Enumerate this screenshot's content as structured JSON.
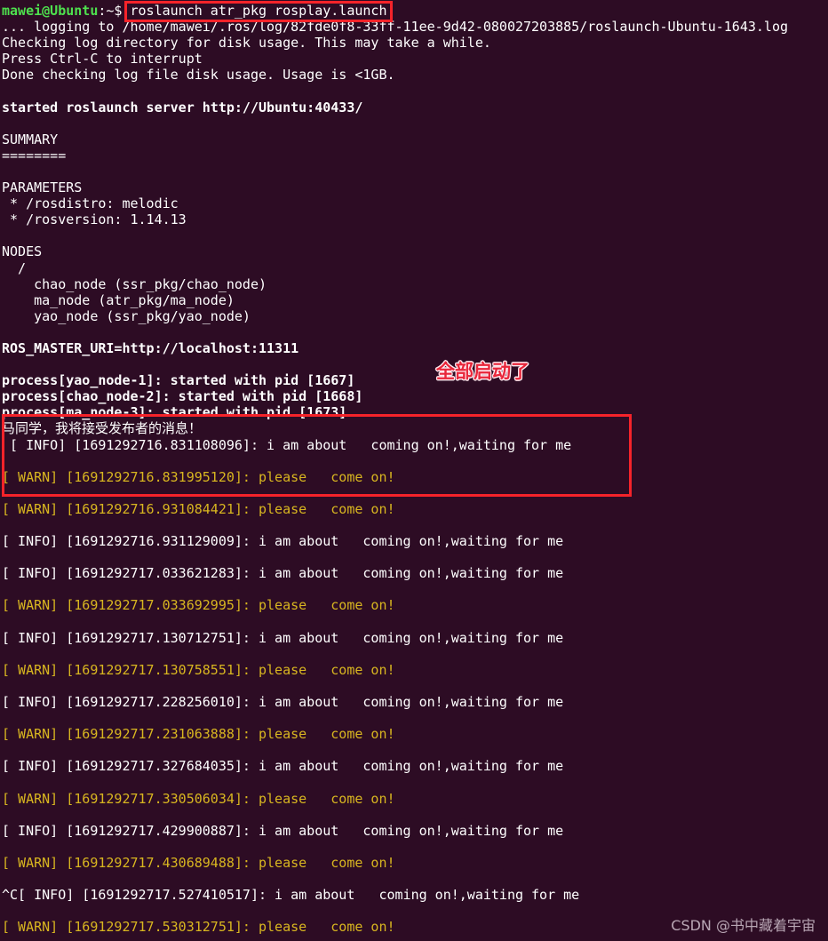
{
  "terminal": {
    "background_color": "#2d0c24",
    "prompt": {
      "user_host": "mawei@Ubuntu",
      "path_sign": ":~$",
      "command": "roslaunch atr_pkg rosplay.launch"
    },
    "colors": {
      "prompt_green": "#4ee04e",
      "info_white": "#ffffff",
      "warn_yellow": "#d8b620",
      "annotation_red": "#e8263a",
      "box_red": "#f5232a"
    },
    "lines": [
      {
        "id": "log-to",
        "text": "... logging to /home/mawei/.ros/log/82fde0f8-33ff-11ee-9d42-080027203885/roslaunch-Ubuntu-1643.log",
        "style": "c-white"
      },
      {
        "id": "checking-log",
        "text": "Checking log directory for disk usage. This may take a while.",
        "style": "c-white"
      },
      {
        "id": "press-ctrl-c",
        "text": "Press Ctrl-C to interrupt",
        "style": "c-white"
      },
      {
        "id": "done-checking",
        "text": "Done checking log file disk usage. Usage is <1GB.",
        "style": "c-white"
      },
      {
        "id": "blank-1",
        "text": " ",
        "style": "blank"
      },
      {
        "id": "started-server",
        "text": "started roslaunch server http://Ubuntu:40433/",
        "style": "c-bold"
      },
      {
        "id": "blank-2",
        "text": " ",
        "style": "blank"
      },
      {
        "id": "summary",
        "text": "SUMMARY",
        "style": "c-white"
      },
      {
        "id": "summary-rule",
        "text": "========",
        "style": "c-white"
      },
      {
        "id": "blank-3",
        "text": " ",
        "style": "blank"
      },
      {
        "id": "parameters",
        "text": "PARAMETERS",
        "style": "c-white"
      },
      {
        "id": "param-distro",
        "text": " * /rosdistro: melodic",
        "style": "c-white"
      },
      {
        "id": "param-version",
        "text": " * /rosversion: 1.14.13",
        "style": "c-white"
      },
      {
        "id": "blank-4",
        "text": " ",
        "style": "blank"
      },
      {
        "id": "nodes",
        "text": "NODES",
        "style": "c-white"
      },
      {
        "id": "nodes-root",
        "text": "  /",
        "style": "c-white"
      },
      {
        "id": "node-chao",
        "text": "    chao_node (ssr_pkg/chao_node)",
        "style": "c-white"
      },
      {
        "id": "node-ma",
        "text": "    ma_node (atr_pkg/ma_node)",
        "style": "c-white"
      },
      {
        "id": "node-yao",
        "text": "    yao_node (ssr_pkg/yao_node)",
        "style": "c-white"
      },
      {
        "id": "blank-5",
        "text": " ",
        "style": "blank"
      },
      {
        "id": "ros-master",
        "text": "ROS_MASTER_URI=http://localhost:11311",
        "style": "c-bold"
      },
      {
        "id": "blank-6",
        "text": " ",
        "style": "blank"
      },
      {
        "id": "proc-yao",
        "text": "process[yao_node-1]: started with pid [1667]",
        "style": "c-bold"
      },
      {
        "id": "proc-chao",
        "text": "process[chao_node-2]: started with pid [1668]",
        "style": "c-bold"
      },
      {
        "id": "proc-ma",
        "text": "process[ma_node-3]: started with pid [1673]",
        "style": "c-bold"
      },
      {
        "id": "cn-subscriber",
        "text": "马同学，我将接受发布者的消息！",
        "style": "cn-line"
      },
      {
        "id": "info-1",
        "text": " [ INFO] [1691292716.831108096]: i am about   coming on!,waiting for me",
        "style": "c-info"
      },
      {
        "id": "blank-7",
        "text": " ",
        "style": "blank"
      },
      {
        "id": "warn-1",
        "text": "[ WARN] [1691292716.831995120]: please   come on!",
        "style": "c-warn"
      },
      {
        "id": "blank-8",
        "text": " ",
        "style": "blank"
      },
      {
        "id": "warn-2",
        "text": "[ WARN] [1691292716.931084421]: please   come on!",
        "style": "c-warn"
      },
      {
        "id": "blank-9",
        "text": " ",
        "style": "blank"
      },
      {
        "id": "info-2",
        "text": "[ INFO] [1691292716.931129009]: i am about   coming on!,waiting for me",
        "style": "c-info"
      },
      {
        "id": "blank-10",
        "text": " ",
        "style": "blank"
      },
      {
        "id": "info-3",
        "text": "[ INFO] [1691292717.033621283]: i am about   coming on!,waiting for me",
        "style": "c-info"
      },
      {
        "id": "blank-11",
        "text": " ",
        "style": "blank"
      },
      {
        "id": "warn-3",
        "text": "[ WARN] [1691292717.033692995]: please   come on!",
        "style": "c-warn"
      },
      {
        "id": "blank-12",
        "text": " ",
        "style": "blank"
      },
      {
        "id": "info-4",
        "text": "[ INFO] [1691292717.130712751]: i am about   coming on!,waiting for me",
        "style": "c-info"
      },
      {
        "id": "blank-13",
        "text": " ",
        "style": "blank"
      },
      {
        "id": "warn-4",
        "text": "[ WARN] [1691292717.130758551]: please   come on!",
        "style": "c-warn"
      },
      {
        "id": "blank-14",
        "text": " ",
        "style": "blank"
      },
      {
        "id": "info-5",
        "text": "[ INFO] [1691292717.228256010]: i am about   coming on!,waiting for me",
        "style": "c-info"
      },
      {
        "id": "blank-15",
        "text": " ",
        "style": "blank"
      },
      {
        "id": "warn-5",
        "text": "[ WARN] [1691292717.231063888]: please   come on!",
        "style": "c-warn"
      },
      {
        "id": "blank-16",
        "text": " ",
        "style": "blank"
      },
      {
        "id": "info-6",
        "text": "[ INFO] [1691292717.327684035]: i am about   coming on!,waiting for me",
        "style": "c-info"
      },
      {
        "id": "blank-17",
        "text": " ",
        "style": "blank"
      },
      {
        "id": "warn-6",
        "text": "[ WARN] [1691292717.330506034]: please   come on!",
        "style": "c-warn"
      },
      {
        "id": "blank-18",
        "text": " ",
        "style": "blank"
      },
      {
        "id": "info-7",
        "text": "[ INFO] [1691292717.429900887]: i am about   coming on!,waiting for me",
        "style": "c-info"
      },
      {
        "id": "blank-19",
        "text": " ",
        "style": "blank"
      },
      {
        "id": "warn-7",
        "text": "[ WARN] [1691292717.430689488]: please   come on!",
        "style": "c-warn"
      },
      {
        "id": "blank-20",
        "text": " ",
        "style": "blank"
      },
      {
        "id": "info-8",
        "text": "^C[ INFO] [1691292717.527410517]: i am about   coming on!,waiting for me",
        "style": "c-info"
      },
      {
        "id": "blank-21",
        "text": " ",
        "style": "blank"
      },
      {
        "id": "warn-8",
        "text": "[ WARN] [1691292717.530312751]: please   come on!",
        "style": "c-warn"
      }
    ]
  },
  "annotations": {
    "started_note": "全部启动了"
  },
  "watermark": {
    "text": "CSDN @书中藏着宇宙"
  }
}
